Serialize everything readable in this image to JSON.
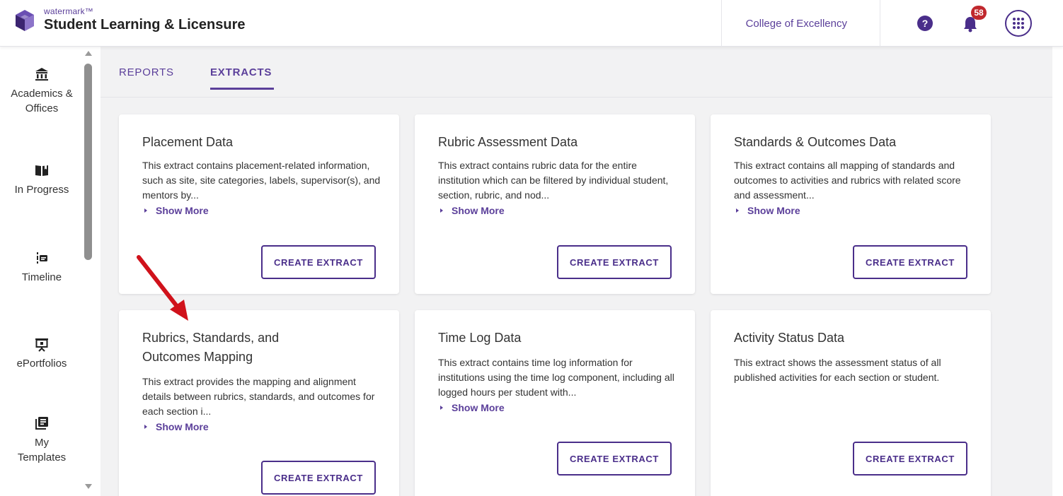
{
  "header": {
    "brand_small": "watermark™",
    "app_title": "Student Learning & Licensure",
    "institution": "College of Excellency",
    "help_icon": "question-circle-icon",
    "notifications_count": "58",
    "apps_icon": "grid-apps-icon"
  },
  "nav": {
    "items": [
      {
        "label": "Academics & Offices",
        "icon": "institution-icon"
      },
      {
        "label": "In Progress",
        "icon": "open-book-icon"
      },
      {
        "label": "Timeline",
        "icon": "timeline-icon"
      },
      {
        "label": "ePortfolios",
        "icon": "presentation-icon"
      },
      {
        "label": "My Templates",
        "icon": "templates-icon"
      }
    ]
  },
  "tabs": [
    {
      "label": "REPORTS",
      "active": false
    },
    {
      "label": "EXTRACTS",
      "active": true
    }
  ],
  "cards": [
    {
      "title": "Placement Data",
      "description": "This extract contains placement-related information, such as site, site categories, labels, supervisor(s), and mentors by...",
      "show_more": "Show More",
      "button": "CREATE EXTRACT"
    },
    {
      "title": "Rubric Assessment Data",
      "description": "This extract contains rubric data for the entire institution which can be filtered by individual student, section, rubric, and nod...",
      "show_more": "Show More",
      "button": "CREATE EXTRACT"
    },
    {
      "title": "Standards & Outcomes Data",
      "description": "This extract contains all mapping of standards and outcomes to activities and rubrics with related score and assessment...",
      "show_more": "Show More",
      "button": "CREATE EXTRACT"
    },
    {
      "title": "Rubrics, Standards, and Outcomes Mapping",
      "description": "This extract provides the mapping and alignment details between rubrics, standards, and outcomes for each section i...",
      "show_more": "Show More",
      "button": "CREATE EXTRACT"
    },
    {
      "title": "Time Log Data",
      "description": "This extract contains time log information for institutions using the time log component, including all logged hours per student with...",
      "show_more": "Show More",
      "button": "CREATE EXTRACT"
    },
    {
      "title": "Activity Status Data",
      "description": "This extract shows the assessment status of all published activities for each section or student.",
      "button": "CREATE EXTRACT"
    }
  ],
  "colors": {
    "accent": "#5b3f9a",
    "badge": "#c0282d",
    "annotation_arrow": "#d0121b"
  }
}
